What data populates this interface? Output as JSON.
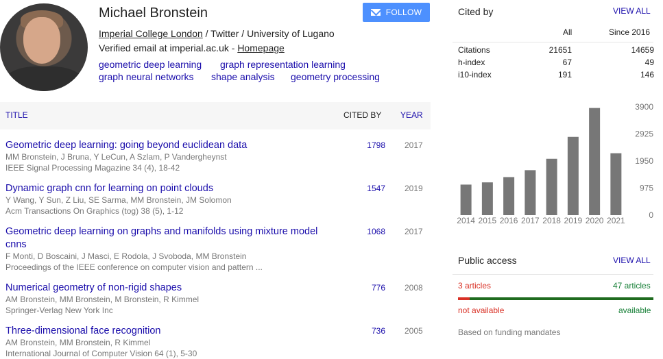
{
  "profile": {
    "name": "Michael Bronstein",
    "follow_label": "FOLLOW",
    "affiliation_link": "Imperial College London",
    "affiliation_rest": " / Twitter / University of Lugano",
    "verified_text": "Verified email at imperial.ac.uk - ",
    "homepage_label": "Homepage",
    "interests": [
      "geometric deep learning",
      "graph representation learning",
      "graph neural networks",
      "shape analysis",
      "geometry processing"
    ]
  },
  "table": {
    "headers": {
      "title": "TITLE",
      "cited_by": "CITED BY",
      "year": "YEAR"
    },
    "rows": [
      {
        "title": "Geometric deep learning: going beyond euclidean data",
        "authors": "MM Bronstein, J Bruna, Y LeCun, A Szlam, P Vandergheynst",
        "venue": "IEEE Signal Processing Magazine 34 (4), 18-42",
        "cited": "1798",
        "year": "2017"
      },
      {
        "title": "Dynamic graph cnn for learning on point clouds",
        "authors": "Y Wang, Y Sun, Z Liu, SE Sarma, MM Bronstein, JM Solomon",
        "venue": "Acm Transactions On Graphics (tog) 38 (5), 1-12",
        "cited": "1547",
        "year": "2019"
      },
      {
        "title": "Geometric deep learning on graphs and manifolds using mixture model cnns",
        "authors": "F Monti, D Boscaini, J Masci, E Rodola, J Svoboda, MM Bronstein",
        "venue": "Proceedings of the IEEE conference on computer vision and pattern ...",
        "cited": "1068",
        "year": "2017"
      },
      {
        "title": "Numerical geometry of non-rigid shapes",
        "authors": "AM Bronstein, MM Bronstein, M Bronstein, R Kimmel",
        "venue": "Springer-Verlag New York Inc",
        "cited": "776",
        "year": "2008"
      },
      {
        "title": "Three-dimensional face recognition",
        "authors": "AM Bronstein, MM Bronstein, R Kimmel",
        "venue": "International Journal of Computer Vision 64 (1), 5-30",
        "cited": "736",
        "year": "2005"
      }
    ]
  },
  "cited_panel": {
    "title": "Cited by",
    "view_all": "VIEW ALL",
    "col_all": "All",
    "col_since": "Since 2016",
    "stats": [
      {
        "label": "Citations",
        "all": "21651",
        "since": "14659"
      },
      {
        "label": "h-index",
        "all": "67",
        "since": "49"
      },
      {
        "label": "i10-index",
        "all": "191",
        "since": "146"
      }
    ]
  },
  "chart_data": {
    "type": "bar",
    "categories": [
      "2014",
      "2015",
      "2016",
      "2017",
      "2018",
      "2019",
      "2020",
      "2021"
    ],
    "values": [
      1100,
      1180,
      1370,
      1620,
      2030,
      2820,
      3860,
      2230
    ],
    "ylim": [
      0,
      3900
    ],
    "yticks": [
      "3900",
      "2925",
      "1950",
      "975",
      "0"
    ],
    "bar_color": "#777777"
  },
  "public_access": {
    "title": "Public access",
    "view_all": "VIEW ALL",
    "left_count": "3 articles",
    "right_count": "47 articles",
    "left_label": "not available",
    "right_label": "available",
    "available_fraction": 0.94,
    "note": "Based on funding mandates"
  }
}
